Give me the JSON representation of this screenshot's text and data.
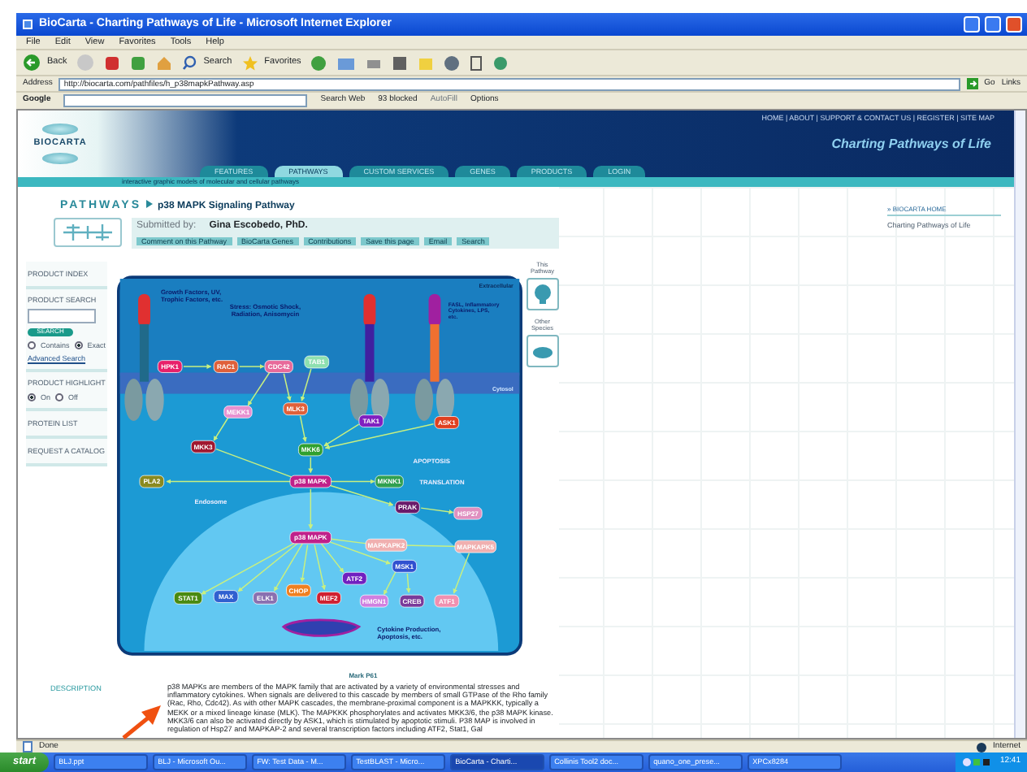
{
  "window": {
    "title": "BioCarta - Charting Pathways of Life - Microsoft Internet Explorer"
  },
  "menu": [
    "File",
    "Edit",
    "View",
    "Favorites",
    "Tools",
    "Help"
  ],
  "toolbar": {
    "back": "Back",
    "search": "Search",
    "favorites": "Favorites"
  },
  "address": {
    "label": "Address",
    "url": "http://biocarta.com/pathfiles/h_p38mapkPathway.asp",
    "go": "Go",
    "links": "Links"
  },
  "google_bar": {
    "brand": "Google",
    "search": "Search Web",
    "blocked": "93 blocked",
    "autofill": "AutoFill",
    "options": "Options"
  },
  "site": {
    "logo": "BIOCARTA",
    "top_links": "HOME | ABOUT | SUPPORT & CONTACT US | REGISTER | SITE MAP",
    "tagline": "Charting Pathways of Life",
    "tabs": [
      {
        "label": "FEATURES",
        "selected": false
      },
      {
        "label": "PATHWAYS",
        "selected": true
      },
      {
        "label": "CUSTOM SERVICES",
        "selected": false
      },
      {
        "label": "GENES",
        "selected": false
      },
      {
        "label": "PRODUCTS",
        "selected": false
      },
      {
        "label": "LOGIN",
        "selected": false
      }
    ],
    "subtitle": "interactive graphic models of molecular and cellular pathways"
  },
  "pathway": {
    "section": "PATHWAYS",
    "title": "p38 MAPK Signaling Pathway",
    "submitted_label": "Submitted by:",
    "author": "Gina Escobedo, PhD.",
    "links": [
      "Comment on this Pathway",
      "BioCarta Genes",
      "Contributions",
      "Save this page",
      "Email",
      "Search"
    ]
  },
  "sidebar": {
    "product_index": "PRODUCT INDEX",
    "product_search": "PRODUCT SEARCH",
    "search_button": "SEARCH",
    "match": [
      {
        "label": "Contains",
        "selected": false
      },
      {
        "label": "Exact",
        "selected": true
      }
    ],
    "advanced": "Advanced Search",
    "highlight": "PRODUCT HIGHLIGHT",
    "highlight_options": [
      {
        "label": "On",
        "selected": true
      },
      {
        "label": "Off",
        "selected": false
      }
    ],
    "protein_list": "PROTEIN LIST",
    "catalog": "REQUEST A CATALOG"
  },
  "diagram": {
    "regions": [
      "Extracellular",
      "Cytosol"
    ],
    "stimuli": [
      "Growth Factors, UV, Trophic Factors, etc.",
      "Stress: Osmotic Shock, Radiation, Anisomycin",
      "FASL, Inflammatory Cytokines, LPS, etc."
    ],
    "processes": [
      "APOPTOSIS",
      "TRANSLATION",
      "Endosome",
      "Cytokine Production, Apoptosis, etc."
    ],
    "nodes": [
      {
        "label": "HPK1",
        "color": "#e8206a"
      },
      {
        "label": "RAC1",
        "color": "#e0603a"
      },
      {
        "label": "CDC42",
        "color": "#e86a9a"
      },
      {
        "label": "TAB1",
        "color": "#8ee0b0"
      },
      {
        "label": "MEKK1",
        "color": "#e890d0"
      },
      {
        "label": "MLK3",
        "color": "#e0603a"
      },
      {
        "label": "TAK1",
        "color": "#8020c0"
      },
      {
        "label": "ASK1",
        "color": "#e04020"
      },
      {
        "label": "MKK3",
        "color": "#a01830"
      },
      {
        "label": "MKK6",
        "color": "#30a030"
      },
      {
        "label": "PLA2",
        "color": "#8a8a20"
      },
      {
        "label": "p38 MAPK",
        "color": "#c0208a"
      },
      {
        "label": "MKNK1",
        "color": "#30a050"
      },
      {
        "label": "PRAK",
        "color": "#6a1a6a"
      },
      {
        "label": "HSP27",
        "color": "#e090c0"
      },
      {
        "label": "p38 MAPK",
        "color": "#c0208a"
      },
      {
        "label": "MAPKAPK2",
        "color": "#f0b0b0"
      },
      {
        "label": "MAPKAPK5",
        "color": "#f0b0b0"
      },
      {
        "label": "MSK1",
        "color": "#3050d0"
      },
      {
        "label": "ATF2",
        "color": "#7020c0"
      },
      {
        "label": "STAT1",
        "color": "#4a8a10"
      },
      {
        "label": "MAX",
        "color": "#3060d0"
      },
      {
        "label": "ELK1",
        "color": "#8a70b0"
      },
      {
        "label": "CHOP",
        "color": "#f08020"
      },
      {
        "label": "MEF2",
        "color": "#d02030"
      },
      {
        "label": "HMGN1",
        "color": "#d080e0"
      },
      {
        "label": "CREB",
        "color": "#7a3a9a"
      },
      {
        "label": "ATF1",
        "color": "#f090b0"
      }
    ]
  },
  "thumbnails": [
    "This Pathway",
    "Other Species"
  ],
  "right_panel": {
    "link": "» BIOCARTA HOME",
    "tagline": "Charting Pathways of Life"
  },
  "caption": "Mark P61",
  "description": {
    "label": "DESCRIPTION",
    "text": "p38 MAPKs are members of the MAPK family that are activated by a variety of environmental stresses and inflammatory cytokines. When signals are delivered to this cascade by members of small GTPase of the Rho family (Rac, Rho, Cdc42). As with other MAPK cascades, the membrane-proximal component is a MAPKKK, typically a MEKK or a mixed lineage kinase (MLK). The MAPKKK phosphorylates and activates MKK3/6, the p38 MAPK kinase. MKK3/6 can also be activated directly by ASK1, which is stimulated by apoptotic stimuli. P38 MAP is involved in regulation of Hsp27 and MAPKAP-2 and several transcription factors including ATF2, Stat1, Gal"
  },
  "status_bar": {
    "text": "Done",
    "zone": "Internet"
  },
  "taskbar": {
    "start": "start",
    "tasks": [
      {
        "label": "BLJ.ppt",
        "selected": false
      },
      {
        "label": "BLJ - Microsoft Ou...",
        "selected": false
      },
      {
        "label": "FW: Test Data - M...",
        "selected": false
      },
      {
        "label": "TestBLAST - Micro...",
        "selected": false
      },
      {
        "label": "BioCarta - Charti...",
        "selected": true
      },
      {
        "label": "Collinis Tool2 doc...",
        "selected": false
      },
      {
        "label": "quano_one_prese...",
        "selected": false
      },
      {
        "label": "XPCx8284",
        "selected": false
      }
    ],
    "clock": "12:41"
  }
}
